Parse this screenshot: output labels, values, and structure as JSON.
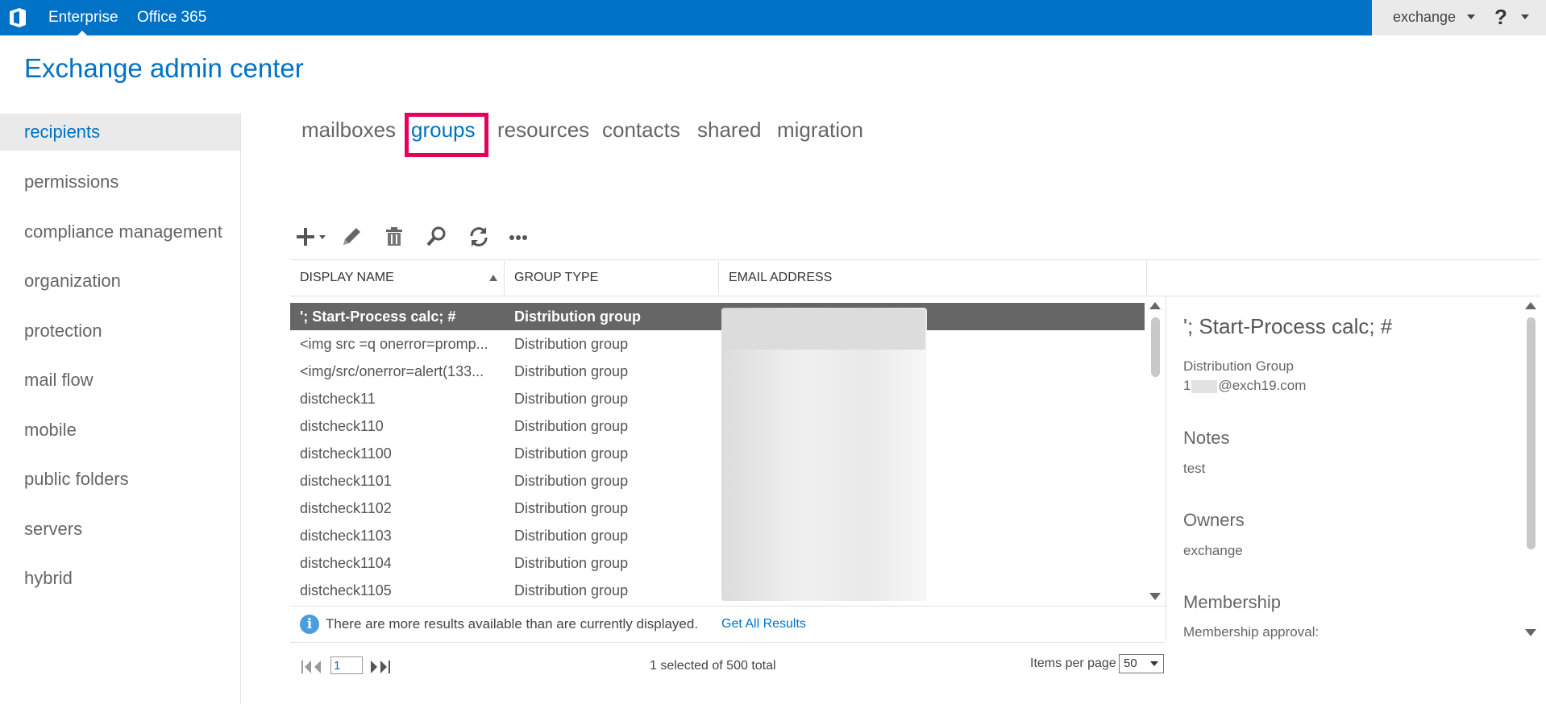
{
  "topbar": {
    "enterprise": "Enterprise",
    "office365": "Office 365",
    "user": "exchange",
    "help": "?"
  },
  "app_title": "Exchange admin center",
  "left_nav": [
    {
      "label": "recipients",
      "active": true
    },
    {
      "label": "permissions"
    },
    {
      "label": "compliance management"
    },
    {
      "label": "organization"
    },
    {
      "label": "protection"
    },
    {
      "label": "mail flow"
    },
    {
      "label": "mobile"
    },
    {
      "label": "public folders"
    },
    {
      "label": "servers"
    },
    {
      "label": "hybrid"
    }
  ],
  "tabs": [
    {
      "label": "mailboxes"
    },
    {
      "label": "groups",
      "active": true
    },
    {
      "label": "resources"
    },
    {
      "label": "contacts"
    },
    {
      "label": "shared"
    },
    {
      "label": "migration"
    }
  ],
  "toolbar": {
    "icons": [
      "add-icon",
      "edit-icon",
      "delete-icon",
      "search-icon",
      "refresh-icon",
      "more-icon"
    ]
  },
  "table": {
    "columns": [
      "DISPLAY NAME",
      "GROUP TYPE",
      "EMAIL ADDRESS"
    ],
    "rows": [
      {
        "name": "'; Start-Process calc; #",
        "type": "Distribution group",
        "selected": true
      },
      {
        "name": "<img src =q onerror=promp...",
        "type": "Distribution group"
      },
      {
        "name": "<img/src/onerror=alert(133...",
        "type": "Distribution group"
      },
      {
        "name": "distcheck11",
        "type": "Distribution group"
      },
      {
        "name": "distcheck110",
        "type": "Distribution group"
      },
      {
        "name": "distcheck1100",
        "type": "Distribution group"
      },
      {
        "name": "distcheck1101",
        "type": "Distribution group"
      },
      {
        "name": "distcheck1102",
        "type": "Distribution group"
      },
      {
        "name": "distcheck1103",
        "type": "Distribution group"
      },
      {
        "name": "distcheck1104",
        "type": "Distribution group"
      },
      {
        "name": "distcheck1105",
        "type": "Distribution group"
      }
    ]
  },
  "info": {
    "text": "There are more results available than are currently displayed.",
    "link": "Get All Results"
  },
  "pager": {
    "page": "1",
    "selected_summary": "1 selected of 500 total",
    "items_per_page_label": "Items per page",
    "items_per_page": "50"
  },
  "details": {
    "title": "'; Start-Process calc; #",
    "group_type": "Distribution Group",
    "email_prefix": "1",
    "email_suffix": "@exch19.com",
    "notes_heading": "Notes",
    "notes_value": "test",
    "owners_heading": "Owners",
    "owners_value": "exchange",
    "membership_heading": "Membership",
    "membership_approval": "Membership approval:"
  },
  "colors": {
    "brand": "#0072c6",
    "highlight": "#e6005c",
    "selected_row": "#666666"
  }
}
